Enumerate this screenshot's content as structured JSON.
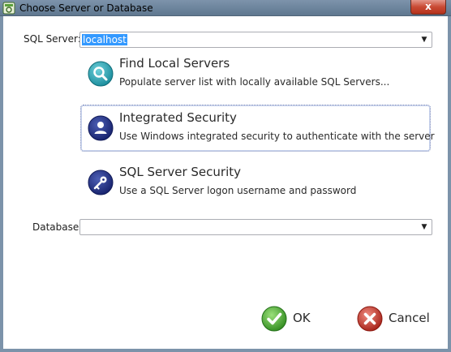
{
  "window": {
    "title": "Choose Server or Database",
    "close_label": "x"
  },
  "sql_server": {
    "label": "SQL Server:",
    "value": "localhost"
  },
  "options": [
    {
      "title": "Find Local Servers",
      "description": "Populate server list with locally available SQL Servers...",
      "icon": "search-icon"
    },
    {
      "title": "Integrated Security",
      "description": "Use Windows integrated security to authenticate with the server",
      "icon": "user-icon"
    },
    {
      "title": "SQL Server Security",
      "description": "Use a SQL Server logon username and password",
      "icon": "key-icon"
    }
  ],
  "database": {
    "label": "Database:",
    "value": ""
  },
  "buttons": {
    "ok": "OK",
    "cancel": "Cancel"
  },
  "colors": {
    "titlebar": "#6f879f",
    "selection": "#3399ff",
    "focus_border": "#6d7fb7",
    "ok_green": "#4aa52e",
    "cancel_red": "#c8342a"
  }
}
